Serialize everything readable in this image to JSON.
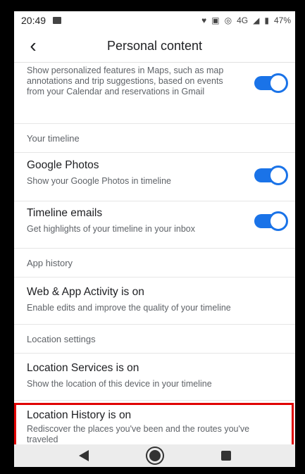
{
  "status_bar": {
    "time": "20:49",
    "battery": "47%",
    "network": "4G"
  },
  "app_bar": {
    "title": "Personal content",
    "back_icon": "chevron-left-icon"
  },
  "settings": {
    "personalized_features": {
      "desc": "Show personalized features in Maps, such as map annotations and trip suggestions, based on events from your Calendar and reservations in Gmail",
      "enabled": true
    },
    "section_timeline": "Your timeline",
    "google_photos": {
      "title": "Google Photos",
      "desc": "Show your Google Photos in timeline",
      "enabled": true
    },
    "timeline_emails": {
      "title": "Timeline emails",
      "desc": "Get highlights of your timeline in your inbox",
      "enabled": true
    },
    "section_app_history": "App history",
    "web_app_activity": {
      "title": "Web & App Activity is on",
      "desc": "Enable edits and improve the quality of your timeline"
    },
    "section_location": "Location settings",
    "location_services": {
      "title": "Location Services is on",
      "desc": "Show the location of this device in your timeline"
    },
    "location_history": {
      "title": "Location History is on",
      "desc": "Rediscover the places you've been and the routes you've traveled"
    }
  },
  "colors": {
    "accent": "#1a73e8",
    "highlight": "#e00000"
  }
}
